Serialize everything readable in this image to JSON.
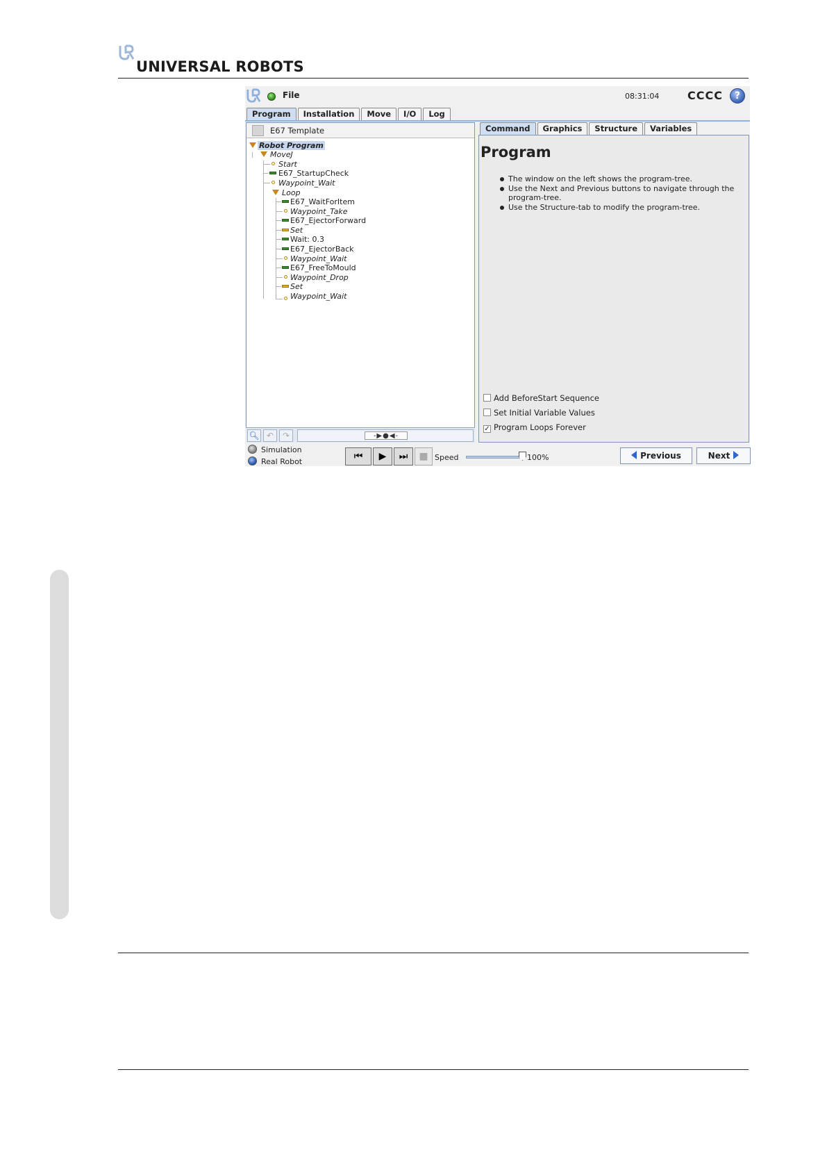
{
  "header": {
    "brand": "UNIVERSAL ROBOTS",
    "logo_icon": "ur-logo-icon"
  },
  "ui": {
    "menu": {
      "file_label": "File"
    },
    "clock": "08:31:04",
    "robot_name": "CCCC",
    "help_label": "?",
    "main_tabs": [
      {
        "label": "Program",
        "active": true
      },
      {
        "label": "Installation"
      },
      {
        "label": "Move"
      },
      {
        "label": "I/O"
      },
      {
        "label": "Log"
      }
    ],
    "program_file": "E67 Template",
    "tree": [
      {
        "label": "Robot Program",
        "type": "root",
        "depth": 0
      },
      {
        "label": "MoveJ",
        "type": "folder",
        "depth": 1
      },
      {
        "label": "Start",
        "type": "waypoint",
        "depth": 2
      },
      {
        "label": "E67_StartupCheck",
        "type": "command",
        "depth": 2
      },
      {
        "label": "Waypoint_Wait",
        "type": "waypoint",
        "depth": 2
      },
      {
        "label": "Loop",
        "type": "folder",
        "depth": 2
      },
      {
        "label": "E67_WaitForItem",
        "type": "command",
        "depth": 3
      },
      {
        "label": "Waypoint_Take",
        "type": "waypoint",
        "depth": 3
      },
      {
        "label": "E67_EjectorForward",
        "type": "command",
        "depth": 3
      },
      {
        "label": "Set",
        "type": "set",
        "depth": 3
      },
      {
        "label": "Wait: 0.3",
        "type": "command",
        "depth": 3
      },
      {
        "label": "E67_EjectorBack",
        "type": "command",
        "depth": 3
      },
      {
        "label": "Waypoint_Wait",
        "type": "waypoint",
        "depth": 3
      },
      {
        "label": "E67_FreeToMould",
        "type": "command",
        "depth": 3
      },
      {
        "label": "Waypoint_Drop",
        "type": "waypoint",
        "depth": 3
      },
      {
        "label": "Set",
        "type": "set",
        "depth": 3
      },
      {
        "label": "Waypoint_Wait",
        "type": "waypoint",
        "depth": 3
      }
    ],
    "right_tabs": [
      {
        "label": "Command",
        "active": true
      },
      {
        "label": "Graphics"
      },
      {
        "label": "Structure"
      },
      {
        "label": "Variables"
      }
    ],
    "panel_title": "Program",
    "bullets": [
      "The window on the left shows the program-tree.",
      "Use the Next and Previous buttons to navigate through the program-tree.",
      "Use the Structure-tab to modify the program-tree."
    ],
    "options": [
      {
        "label": "Add BeforeStart Sequence",
        "checked": false
      },
      {
        "label": "Set Initial Variable Values",
        "checked": false
      },
      {
        "label": "Program Loops Forever",
        "checked": true
      }
    ],
    "modes": [
      {
        "label": "Simulation",
        "selected": false
      },
      {
        "label": "Real Robot",
        "selected": true
      }
    ],
    "speed_label": "Speed",
    "speed_value": "100%",
    "speed_fraction": 1.0,
    "previous_label": "Previous",
    "next_label": "Next",
    "colors": {
      "accent": "#2f67c9",
      "active_tab": "#cfdff1",
      "folder": "#c9861d",
      "command": "#3e8a2e"
    }
  }
}
